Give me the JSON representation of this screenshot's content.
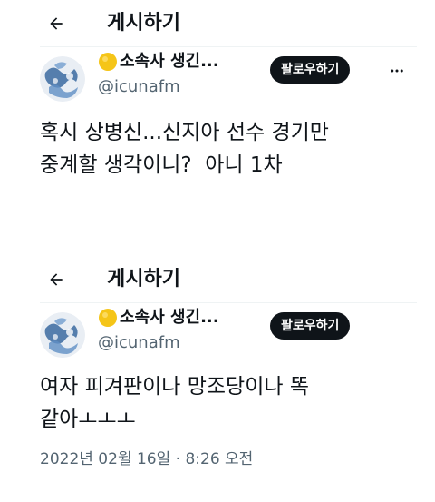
{
  "posts": [
    {
      "header_title": "게시하기",
      "author": {
        "display_name": "소속사 생긴...",
        "handle": "@icunafm",
        "name_emoji": "yellow-circle-emoji"
      },
      "follow_label": "팔로우하기",
      "text": "혹시 상병신...신지아 선수 경기만\n중계할 생각이니?  아니 1차"
    },
    {
      "header_title": "게시하기",
      "author": {
        "display_name": "소속사 생긴...",
        "handle": "@icunafm",
        "name_emoji": "yellow-circle-emoji"
      },
      "follow_label": "팔로우하기",
      "text": "여자 피겨판이나 망조당이나 똑\n같아ㅗㅗㅗ",
      "timestamp": "2022년 02월 16일 · 8:26 오전"
    }
  ],
  "colors": {
    "text_primary": "#0f1419",
    "text_secondary": "#536471",
    "follow_button_bg": "#0f1419",
    "follow_button_text": "#ffffff",
    "divider": "#eff3f4",
    "avatar_blue": "#3b6aa0",
    "emoji_yellow": "#f5c518"
  },
  "icons": {
    "back": "back-arrow-icon",
    "more": "more-icon",
    "avatar": "avatar"
  }
}
